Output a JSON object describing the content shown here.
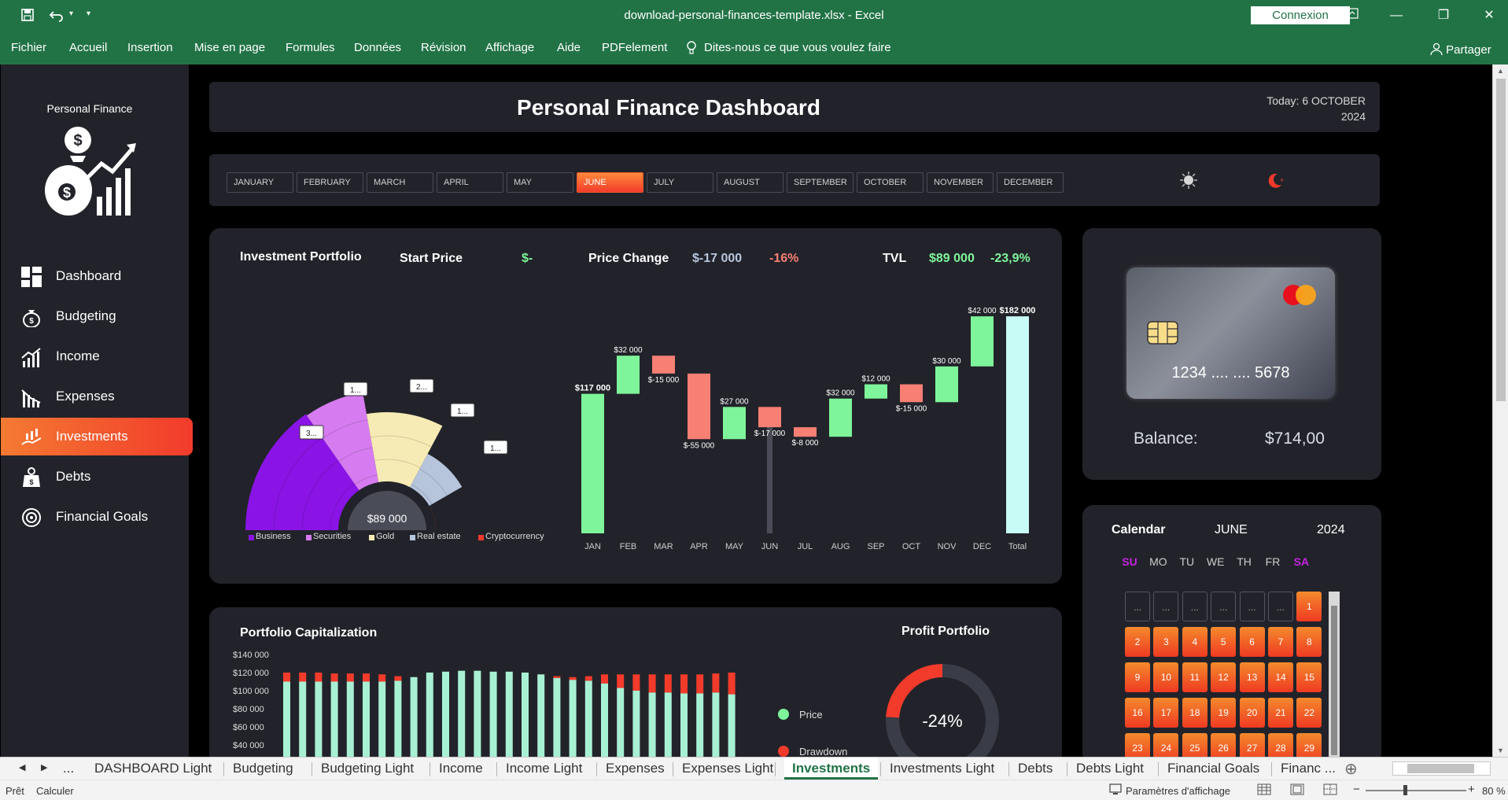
{
  "window": {
    "title": "download-personal-finances-template.xlsx  -  Excel",
    "signin_label": "Connexion",
    "share_label": "Partager"
  },
  "ribbon": {
    "tabs": [
      "Fichier",
      "Accueil",
      "Insertion",
      "Mise en page",
      "Formules",
      "Données",
      "Révision",
      "Affichage",
      "Aide",
      "PDFelement"
    ],
    "tell_me": "Dites-nous ce que vous voulez faire"
  },
  "sidebar": {
    "brand": "Personal Finance",
    "items": [
      {
        "label": "Dashboard",
        "icon": "dashboard-icon",
        "active": false
      },
      {
        "label": "Budgeting",
        "icon": "money-bag-icon",
        "active": false
      },
      {
        "label": "Income",
        "icon": "income-chart-icon",
        "active": false
      },
      {
        "label": "Expenses",
        "icon": "expenses-chart-icon",
        "active": false
      },
      {
        "label": "Investments",
        "icon": "investments-icon",
        "active": true
      },
      {
        "label": "Debts",
        "icon": "debt-weight-icon",
        "active": false
      },
      {
        "label": "Financial Goals",
        "icon": "target-icon",
        "active": false
      }
    ]
  },
  "header": {
    "title": "Personal Finance Dashboard",
    "today_line1": "Today: 6 OCTOBER",
    "today_line2": "2024"
  },
  "months": {
    "items": [
      "JANUARY",
      "FEBRUARY",
      "MARCH",
      "APRIL",
      "MAY",
      "JUNE",
      "JULY",
      "AUGUST",
      "SEPTEMBER",
      "OCTOBER",
      "NOVEMBER",
      "DECEMBER"
    ],
    "active": "JUNE",
    "theme_icons": [
      "sun-icon",
      "moon-icon"
    ]
  },
  "investment": {
    "title": "Investment Portfolio",
    "start_price_label": "Start Price",
    "start_price_value": "$-",
    "price_change_label": "Price Change",
    "price_change_value": "$-17 000",
    "price_change_pct": "-16%",
    "tvl_label": "TVL",
    "tvl_value": "$89 000",
    "tvl_pct": "-23,9%"
  },
  "colors": {
    "positive": "#7ef59a",
    "negative": "#f77f74",
    "accent": "#f23b2b",
    "panel": "#22232a",
    "total_bar": "#c8fbf5"
  },
  "chart_data": [
    {
      "type": "pie",
      "subtype": "radial-sector",
      "center_label": "$89 000",
      "categories": [
        "Business",
        "Securities",
        "Gold",
        "Real estate",
        "Cryptocurrency"
      ],
      "colors": [
        "#8a14e6",
        "#d67cf0",
        "#f7ebb5",
        "#b6c4dc",
        "#f23b2b"
      ],
      "sector_labels": [
        "3...",
        "1...",
        "2...",
        "1...",
        "1..."
      ]
    },
    {
      "type": "bar",
      "subtype": "waterfall",
      "categories": [
        "JAN",
        "FEB",
        "MAR",
        "APR",
        "MAY",
        "JUN",
        "JUL",
        "AUG",
        "SEP",
        "OCT",
        "NOV",
        "DEC",
        "Total"
      ],
      "values": [
        117000,
        32000,
        -15000,
        -55000,
        27000,
        -17000,
        -8000,
        32000,
        12000,
        -15000,
        30000,
        42000,
        182000
      ],
      "labels": [
        "$117 000",
        "$32 000",
        "$-15 000",
        "$-55 000",
        "$27 000",
        "$-17 000",
        "$-8 000",
        "$32 000",
        "$12 000",
        "$-15 000",
        "$30 000",
        "$42 000",
        "$182 000"
      ],
      "ylim": [
        0,
        190000
      ]
    },
    {
      "type": "bar",
      "subtype": "stacked",
      "title": "Portfolio Capitalization",
      "y_ticks": [
        "$140 000",
        "$120 000",
        "$100 000",
        "$80 000",
        "$60 000",
        "$40 000"
      ],
      "ylim": [
        40000,
        140000
      ],
      "series": [
        {
          "name": "Price",
          "color": "#a8f0d4",
          "values": [
            110000,
            110000,
            110000,
            110000,
            110000,
            110000,
            110000,
            111000,
            115000,
            120000,
            121000,
            122000,
            122000,
            121000,
            121000,
            120000,
            118000,
            114000,
            112000,
            111000,
            108000,
            103000,
            100000,
            98000,
            98000,
            97000,
            97000,
            98000,
            96000
          ]
        },
        {
          "name": "Drawdown",
          "color": "#f23b2b",
          "values": [
            10000,
            10000,
            10000,
            9000,
            9000,
            9000,
            8000,
            5000,
            0,
            0,
            0,
            0,
            0,
            0,
            0,
            0,
            0,
            2000,
            3000,
            5000,
            10000,
            15000,
            18000,
            20000,
            20000,
            21000,
            21000,
            21000,
            24000
          ]
        }
      ]
    },
    {
      "type": "pie",
      "subtype": "donut",
      "title": "Profit Portfolio",
      "center_label": "-24%",
      "values": [
        24,
        76
      ],
      "colors": [
        "#f23b2b",
        "#3a3c47"
      ]
    }
  ],
  "card": {
    "number": "1234 .... .... 5678",
    "balance_label": "Balance:",
    "balance_value": "$714,00"
  },
  "calendar": {
    "title": "Calendar",
    "month": "JUNE",
    "year": "2024",
    "weekdays": [
      "SU",
      "MO",
      "TU",
      "WE",
      "TH",
      "FR",
      "SA"
    ],
    "cells": [
      "...",
      "...",
      "...",
      "...",
      "...",
      "...",
      "1",
      "2",
      "3",
      "4",
      "5",
      "6",
      "7",
      "8",
      "9",
      "10",
      "11",
      "12",
      "13",
      "14",
      "15",
      "16",
      "17",
      "18",
      "19",
      "20",
      "21",
      "22",
      "23",
      "24",
      "25",
      "26",
      "27",
      "28",
      "29"
    ]
  },
  "sheet_tabs": {
    "items": [
      "DASHBOARD Light",
      "Budgeting",
      "Budgeting Light",
      "Income",
      "Income Light",
      "Expenses",
      "Expenses Light",
      "Investments",
      "Investments Light",
      "Debts",
      "Debts Light",
      "Financial Goals",
      "Financ ..."
    ],
    "active": "Investments",
    "overflow": "..."
  },
  "status": {
    "ready": "Prêt",
    "calc": "Calculer",
    "display_settings": "Paramètres d'affichage",
    "zoom": "80 %"
  }
}
